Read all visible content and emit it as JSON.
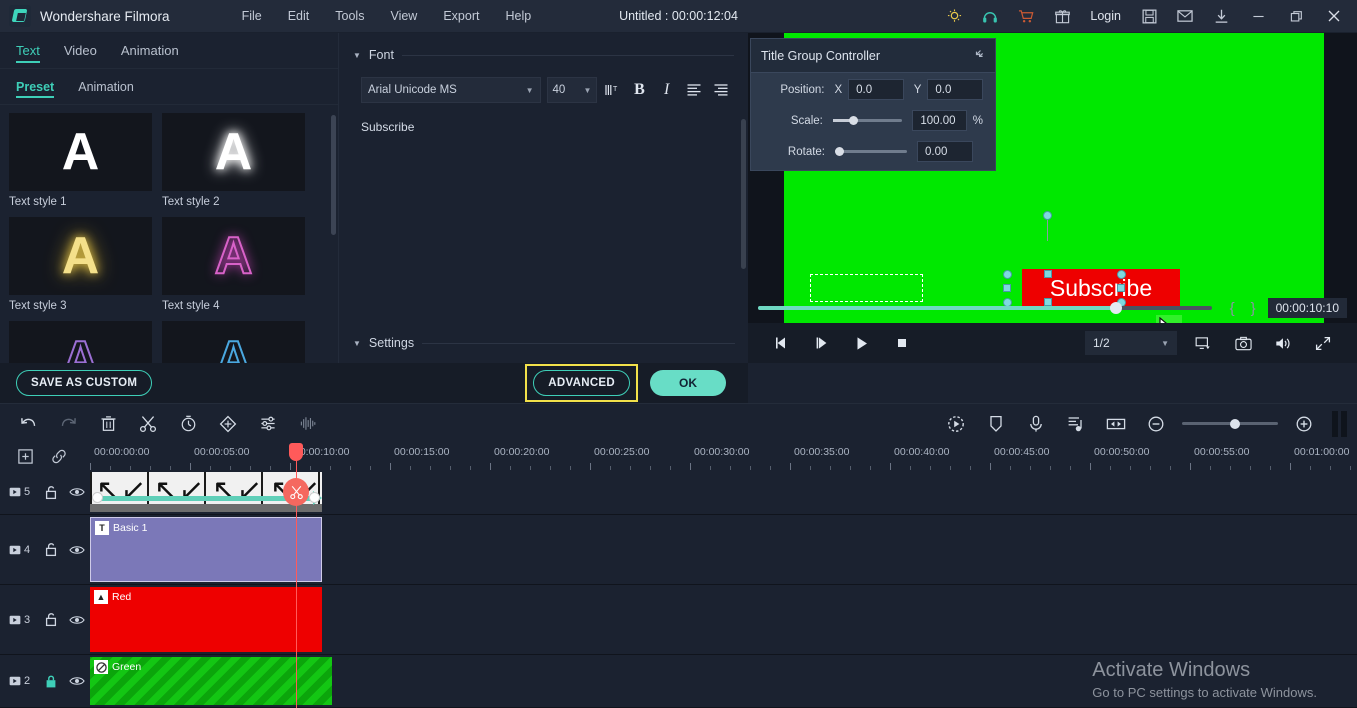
{
  "titlebar": {
    "app_name": "Wondershare Filmora",
    "menus": [
      "File",
      "Edit",
      "Tools",
      "View",
      "Export",
      "Help"
    ],
    "document_title": "Untitled : 00:00:12:04",
    "login_label": "Login",
    "icons": [
      "bulb-icon",
      "headphone-icon",
      "cart-icon",
      "gift-icon",
      "save-icon",
      "mail-icon",
      "download-icon",
      "minimize-icon",
      "restore-icon",
      "close-icon"
    ]
  },
  "left_panel": {
    "top_tabs": [
      {
        "label": "Text",
        "active": true
      },
      {
        "label": "Video",
        "active": false
      },
      {
        "label": "Animation",
        "active": false
      }
    ],
    "sub_tabs": [
      {
        "label": "Preset",
        "active": true
      },
      {
        "label": "Animation",
        "active": false
      }
    ],
    "presets": [
      {
        "label": "Text style 1",
        "glyph": "A",
        "style": "s1"
      },
      {
        "label": "Text style 2",
        "glyph": "A",
        "style": "s2"
      },
      {
        "label": "Text style 3",
        "glyph": "A",
        "style": "s3"
      },
      {
        "label": "Text style 4",
        "glyph": "A",
        "style": "s4"
      },
      {
        "label": "",
        "glyph": "A",
        "style": "s5"
      },
      {
        "label": "",
        "glyph": "A",
        "style": "s6"
      }
    ]
  },
  "properties": {
    "font_section_title": "Font",
    "font_family": "Arial Unicode MS",
    "font_size": "40",
    "text_value": "Subscribe",
    "bold_label": "B",
    "italic_label": "I",
    "settings_section_title": "Settings"
  },
  "dialog_buttons": {
    "save_as_custom": "SAVE AS CUSTOM",
    "advanced": "ADVANCED",
    "ok": "OK",
    "advanced_highlight_color": "#f2e14a",
    "accent_color": "#3ecfb8"
  },
  "title_group_controller": {
    "panel_title": "Title Group Controller",
    "position_label": "Position:",
    "x_label": "X",
    "x_value": "0.0",
    "y_label": "Y",
    "y_value": "0.0",
    "scale_label": "Scale:",
    "scale_value": "100.00",
    "percent": "%",
    "rotate_label": "Rotate:",
    "rotate_value": "0.00"
  },
  "preview": {
    "subscribe_text": "Subscribe",
    "canvas_color": "#00e800",
    "text_bg_color": "#ee0000",
    "timecode": "00:00:10:10",
    "mark_in": "{",
    "mark_out": "}",
    "ratio": "1/2",
    "progress_percent": 79
  },
  "timeline_toolbar": {
    "left_icons": [
      "undo-icon",
      "redo-icon",
      "delete-icon",
      "split-icon",
      "speed-icon",
      "keyframe-icon",
      "color-adjust-icon",
      "audio-waveform-icon"
    ],
    "right_icons": [
      "render-preview-icon",
      "marker-icon",
      "voiceover-icon",
      "audio-detach-icon",
      "fit-timeline-icon",
      "zoom-out-icon",
      "zoom-in-icon"
    ]
  },
  "ruler": {
    "ticks": [
      "00:00:00:00",
      "00:00:05:00",
      "00:00:10:00",
      "00:00:15:00",
      "00:00:20:00",
      "00:00:25:00",
      "00:00:30:00",
      "00:00:35:00",
      "00:00:40:00",
      "00:00:45:00",
      "00:00:50:00",
      "00:00:55:00",
      "00:01:00:00"
    ],
    "playhead_time": "00:00:10:00"
  },
  "tracks": [
    {
      "number": "5",
      "locked": false,
      "visible": true,
      "clip_label": "",
      "kind": "arrows"
    },
    {
      "number": "4",
      "locked": false,
      "visible": true,
      "clip_label": "Basic 1",
      "kind": "text",
      "badge": "T"
    },
    {
      "number": "3",
      "locked": false,
      "visible": true,
      "clip_label": "Red",
      "kind": "image",
      "badge": "▲"
    },
    {
      "number": "2",
      "locked": true,
      "visible": true,
      "clip_label": "Green",
      "kind": "green",
      "badge": "◍"
    }
  ],
  "watermark": {
    "line1": "Activate Windows",
    "line2": "Go to PC settings to activate Windows."
  }
}
